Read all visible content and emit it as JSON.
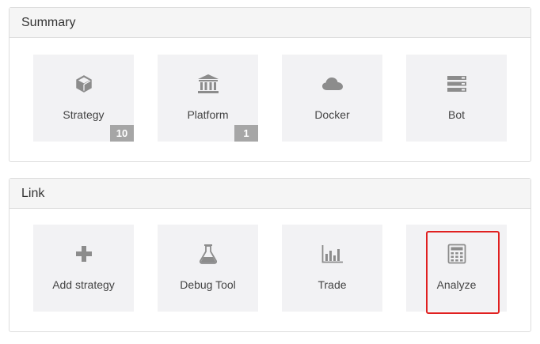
{
  "summary": {
    "title": "Summary",
    "tiles": [
      {
        "label": "Strategy",
        "icon": "cube-icon",
        "badge": "10"
      },
      {
        "label": "Platform",
        "icon": "bank-icon",
        "badge": "1"
      },
      {
        "label": "Docker",
        "icon": "cloud-icon"
      },
      {
        "label": "Bot",
        "icon": "server-icon"
      }
    ]
  },
  "link": {
    "title": "Link",
    "tiles": [
      {
        "label": "Add strategy",
        "icon": "plus-icon"
      },
      {
        "label": "Debug Tool",
        "icon": "flask-icon"
      },
      {
        "label": "Trade",
        "icon": "bar-chart-icon"
      },
      {
        "label": "Analyze",
        "icon": "calculator-icon",
        "highlighted": true
      }
    ]
  },
  "colors": {
    "icon": "#8c8c8c",
    "tile_bg": "#f2f2f4",
    "badge_bg": "#a6a6a6",
    "highlight": "#e02020"
  }
}
